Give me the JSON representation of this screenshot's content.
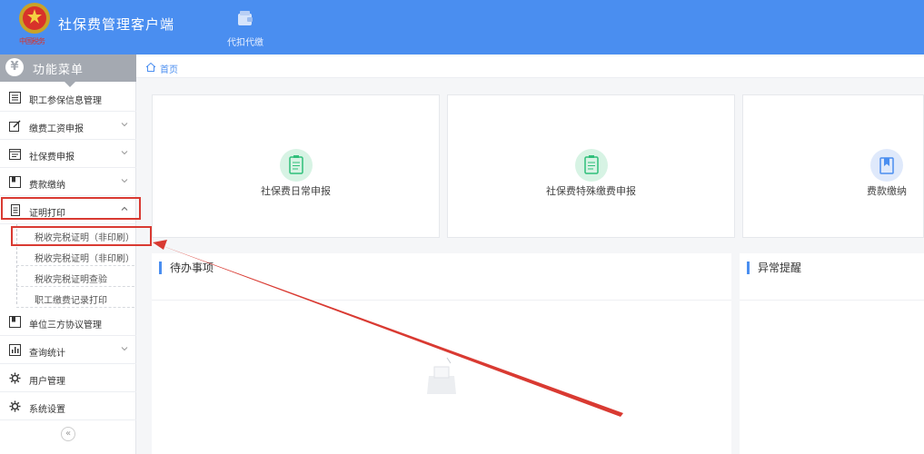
{
  "header": {
    "app_title": "社保费管理客户端",
    "logo_caption": "中国税务",
    "nav": [
      {
        "label": "代扣代缴",
        "icon": "wallet-icon"
      }
    ]
  },
  "sidebar": {
    "title": "功能菜单",
    "items": [
      {
        "label": "职工参保信息管理",
        "icon": "list-icon",
        "expandable": false
      },
      {
        "label": "缴费工资申报",
        "icon": "edit-icon",
        "expandable": true
      },
      {
        "label": "社保费申报",
        "icon": "calendar-icon",
        "expandable": true
      },
      {
        "label": "费款缴纳",
        "icon": "book-icon",
        "expandable": true
      },
      {
        "label": "证明打印",
        "icon": "document-icon",
        "expandable": true,
        "expanded": true
      },
      {
        "label": "单位三方协议管理",
        "icon": "book-icon",
        "expandable": false
      },
      {
        "label": "查询统计",
        "icon": "chart-icon",
        "expandable": true
      },
      {
        "label": "用户管理",
        "icon": "gear-icon",
        "expandable": false
      },
      {
        "label": "系统设置",
        "icon": "gear-icon",
        "expandable": false
      }
    ],
    "submenu": [
      {
        "label": "税收完税证明（非印刷）"
      },
      {
        "label": "税收完税证明（非印刷）"
      },
      {
        "label": "税收完税证明查验"
      },
      {
        "label": "职工缴费记录打印"
      }
    ],
    "collapse_symbol": "«"
  },
  "breadcrumb": {
    "home": "首页"
  },
  "cards": [
    {
      "label": "社保费日常申报",
      "icon": "clipboard-icon",
      "color": "#2fbf7a"
    },
    {
      "label": "社保费特殊缴费申报",
      "icon": "clipboard-icon",
      "color": "#2fbf7a"
    },
    {
      "label": "费款缴纳",
      "icon": "book-icon",
      "color": "#4a8ef0"
    }
  ],
  "panels": {
    "todo": {
      "title": "待办事项"
    },
    "alert": {
      "title": "异常提醒"
    }
  },
  "colors": {
    "header": "#4a8ef0",
    "accent": "#4a8ef0",
    "highlight": "#d93a32",
    "menu_head": "#a4a9b1"
  }
}
